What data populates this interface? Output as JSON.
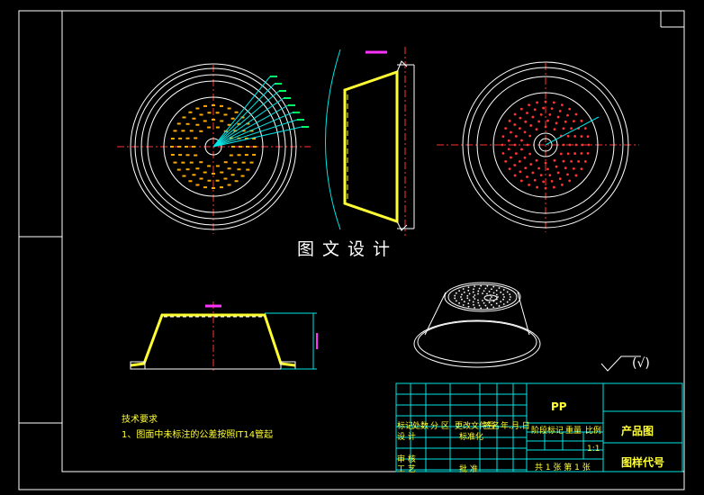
{
  "watermark": "图文设计",
  "notes": {
    "title": "技术要求",
    "line1": "1、图面中未标注的公差按照IT14管起"
  },
  "title_block": {
    "material": "PP",
    "drawing_type": "产品图",
    "drawing_code_label": "图样代号",
    "scale": "1:1",
    "sheet": "共 1 张  第 1 张",
    "row_labels": [
      "标记",
      "处数",
      "分 区",
      "更改文件号",
      "签名",
      "年.月.日"
    ],
    "design": "设 计",
    "standardize": "标准化",
    "stage_label": "阶段标记",
    "weight": "重量",
    "ratio": "比例",
    "review": "审 核",
    "process": "工 艺",
    "approve": "批 准"
  },
  "roughness": "(√)",
  "colors": {
    "outline": "#ffffff",
    "frame": "#ffffff",
    "center": "#ff3333",
    "dim": "#00e5e5",
    "profile": "#ffff33",
    "holes_left": "#ffaa00",
    "holes_right": "#ff3333",
    "tb_grid": "#00e5e5"
  }
}
